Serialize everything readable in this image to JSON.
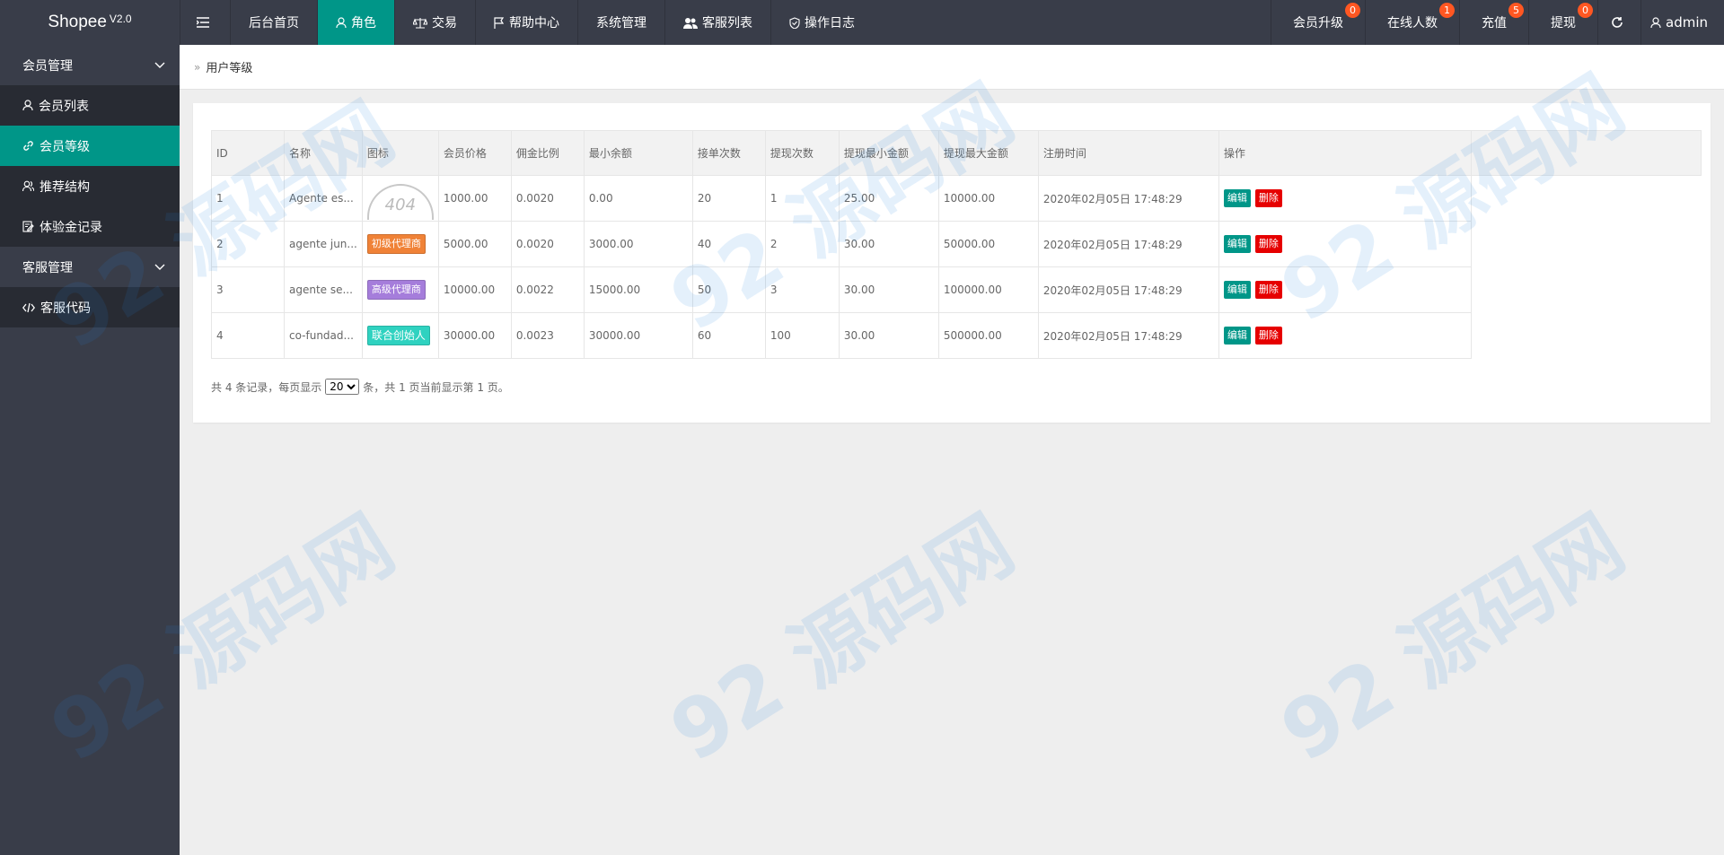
{
  "logo": {
    "name": "Shopee",
    "version": "V2.0"
  },
  "topnav": {
    "left": [
      {
        "label": "后台首页"
      },
      {
        "label": "角色",
        "active": true
      },
      {
        "label": "交易"
      },
      {
        "label": "帮助中心"
      },
      {
        "label": "系统管理"
      },
      {
        "label": "客服列表"
      },
      {
        "label": "操作日志"
      }
    ],
    "right": [
      {
        "label": "会员升级",
        "badge": "0"
      },
      {
        "label": "在线人数",
        "badge": "1"
      },
      {
        "label": "充值",
        "badge": "5"
      },
      {
        "label": "提现",
        "badge": "0"
      }
    ],
    "user": "admin"
  },
  "sidebar": {
    "groups": [
      {
        "label": "会员管理",
        "items": [
          {
            "label": "会员列表",
            "icon": "user-icon"
          },
          {
            "label": "会员等级",
            "icon": "link-icon",
            "active": true
          },
          {
            "label": "推荐结构",
            "icon": "users-icon"
          },
          {
            "label": "体验金记录",
            "icon": "edit-icon"
          }
        ]
      },
      {
        "label": "客服管理",
        "items": [
          {
            "label": "客服代码",
            "icon": "code-icon"
          }
        ]
      }
    ]
  },
  "breadcrumb": {
    "current": "用户等级"
  },
  "table": {
    "headers": [
      "ID",
      "名称",
      "图标",
      "会员价格",
      "佣金比例",
      "最小余额",
      "接单次数",
      "提现次数",
      "提现最小金额",
      "提现最大金额",
      "注册时间",
      "操作"
    ],
    "rows": [
      {
        "id": "1",
        "name": "Agente es...",
        "icon_type": "image-404",
        "icon_text": "404",
        "price": "1000.00",
        "commission": "0.0020",
        "min_balance": "0.00",
        "orders": "20",
        "withdraw_times": "1",
        "withdraw_min": "25.00",
        "withdraw_max": "10000.00",
        "time": "2020年02月05日 17:48:29"
      },
      {
        "id": "2",
        "name": "agente jun...",
        "icon_type": "tag-orange",
        "icon_text": "初级代理商",
        "price": "5000.00",
        "commission": "0.0020",
        "min_balance": "3000.00",
        "orders": "40",
        "withdraw_times": "2",
        "withdraw_min": "30.00",
        "withdraw_max": "50000.00",
        "time": "2020年02月05日 17:48:29"
      },
      {
        "id": "3",
        "name": "agente se...",
        "icon_type": "tag-purple",
        "icon_text": "高级代理商",
        "price": "10000.00",
        "commission": "0.0022",
        "min_balance": "15000.00",
        "orders": "50",
        "withdraw_times": "3",
        "withdraw_min": "30.00",
        "withdraw_max": "100000.00",
        "time": "2020年02月05日 17:48:29"
      },
      {
        "id": "4",
        "name": "co-fundad...",
        "icon_type": "tag-cyan",
        "icon_text": "联合创始人",
        "price": "30000.00",
        "commission": "0.0023",
        "min_balance": "30000.00",
        "orders": "60",
        "withdraw_times": "100",
        "withdraw_min": "30.00",
        "withdraw_max": "500000.00",
        "time": "2020年02月05日 17:48:29"
      }
    ],
    "edit_label": "编辑",
    "delete_label": "删除"
  },
  "pager": {
    "prefix": "共 4 条记录，每页显示",
    "page_size": "20",
    "suffix": "条，共 1 页当前显示第 1 页。"
  },
  "watermark": "92 源码网",
  "colors": {
    "topbar": "#393d49",
    "accent": "#009688",
    "badge": "#ff5722",
    "delete": "#e60000"
  }
}
